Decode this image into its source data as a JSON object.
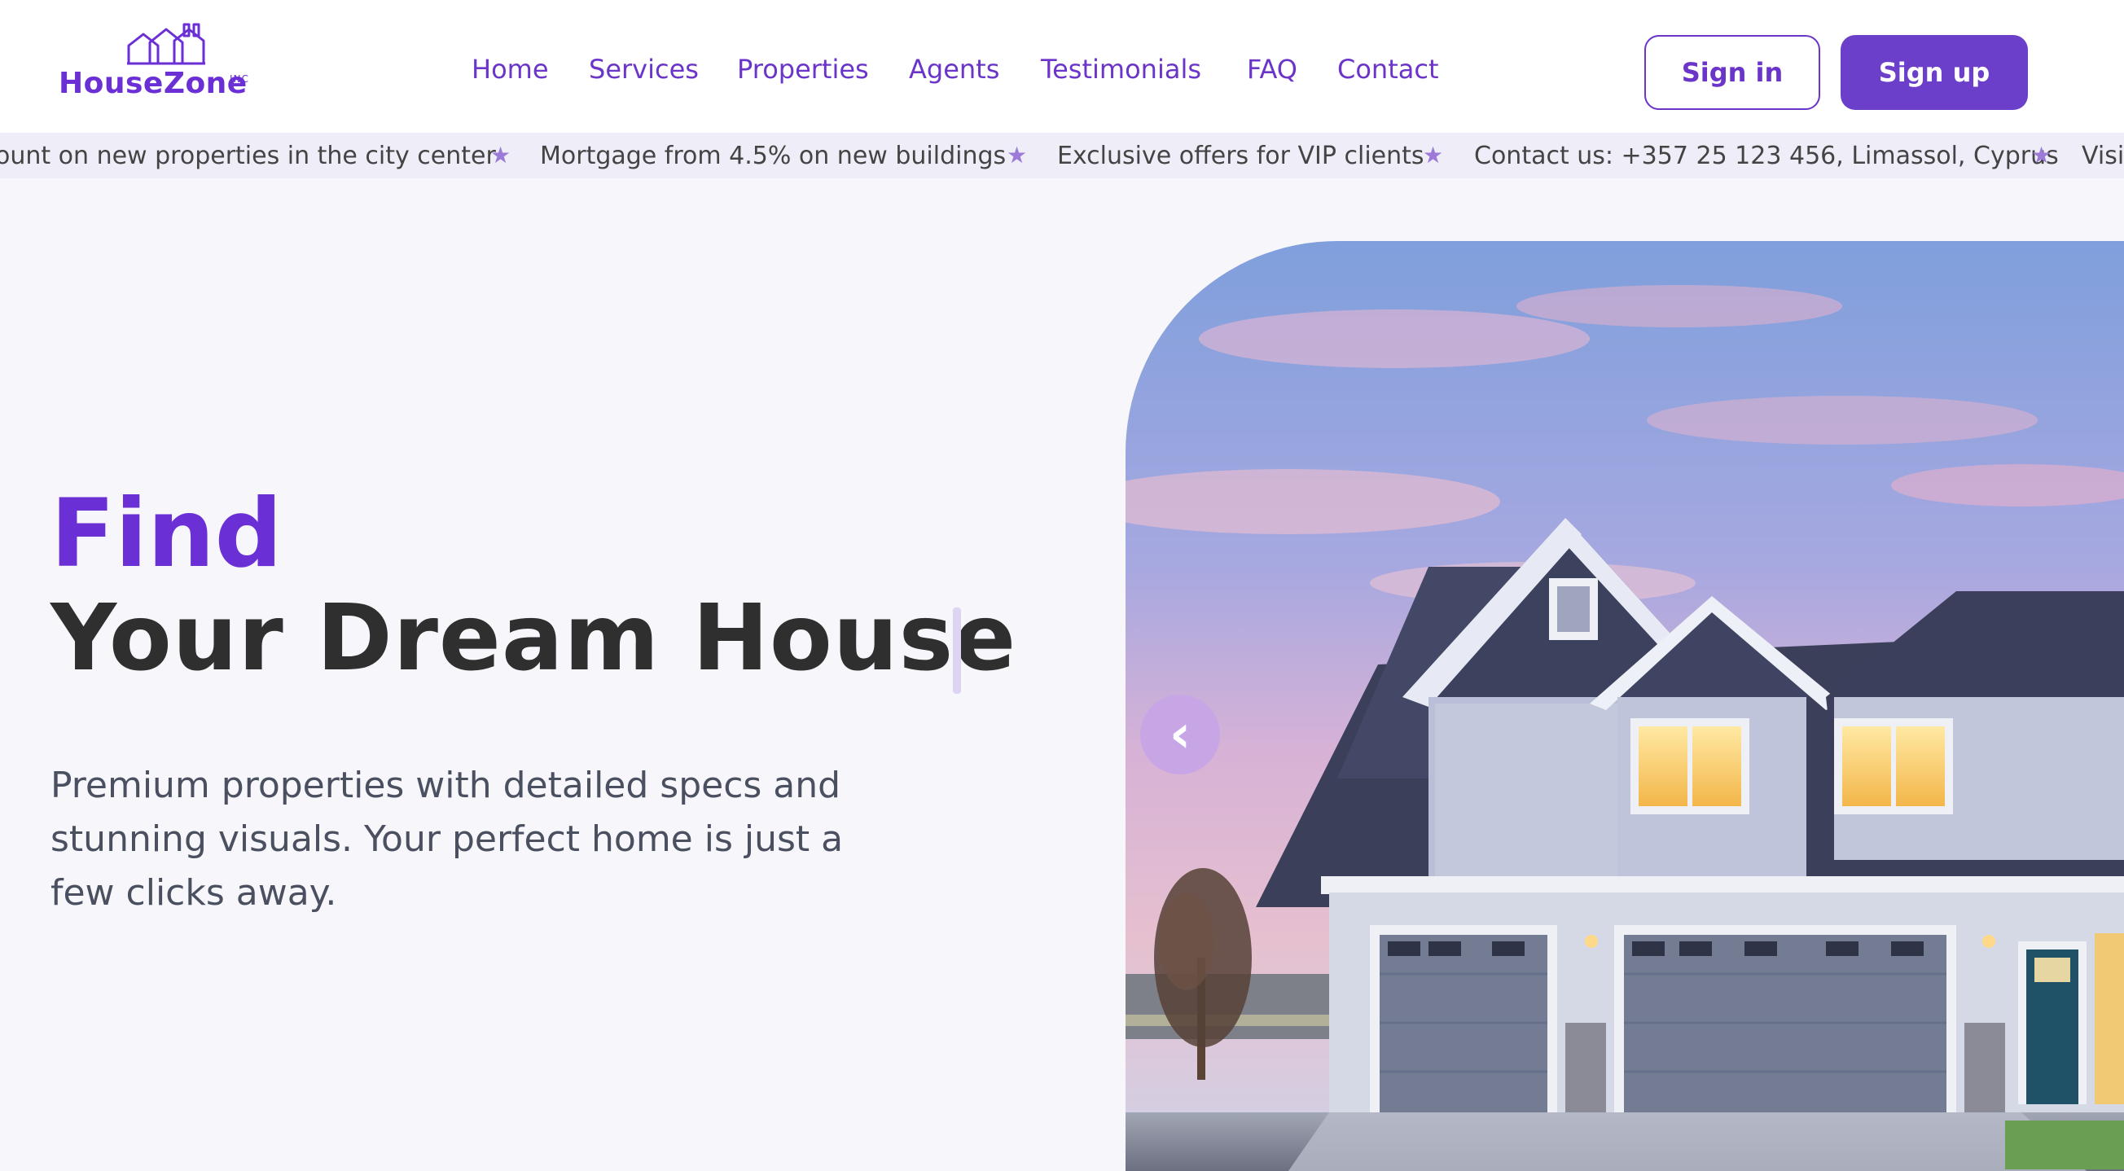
{
  "brand": {
    "name": "HouseZone",
    "suffix": "INC",
    "primary_color": "#6b2fd6",
    "button_color": "#6c3fcb"
  },
  "nav": {
    "items": [
      {
        "label": "Home"
      },
      {
        "label": "Services"
      },
      {
        "label": "Properties"
      },
      {
        "label": "Agents"
      },
      {
        "label": "Testimonials"
      },
      {
        "label": "FAQ"
      },
      {
        "label": "Contact"
      }
    ]
  },
  "auth": {
    "sign_in": "Sign in",
    "sign_up": "Sign up"
  },
  "ticker": {
    "items": [
      "ount on new properties in the city center",
      "Mortgage from 4.5% on new buildings",
      "Exclusive offers for VIP clients",
      "Contact us: +357 25 123 456, Limassol, Cyprus",
      "Visit"
    ],
    "separator_icon": "star-icon"
  },
  "hero": {
    "title_accent": "Find",
    "title_main": "Your Dream House",
    "description": "Premium properties with detailed specs and stunning visuals. Your perfect home is just a few clicks away."
  },
  "slider": {
    "prev_icon": "chevron-left-icon"
  }
}
